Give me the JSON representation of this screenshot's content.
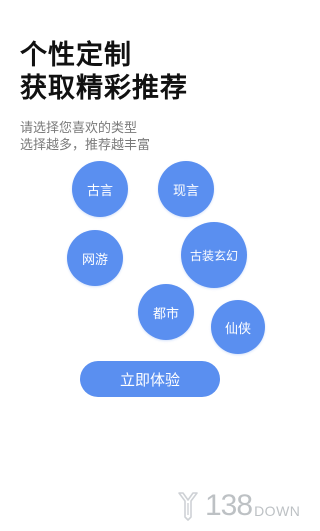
{
  "header": {
    "title_line1": "个性定制",
    "title_line2": "获取精彩推荐"
  },
  "instructions": {
    "line1": "请选择您喜欢的类型",
    "line2": "选择越多，推荐越丰富"
  },
  "genres": [
    {
      "label": "古言"
    },
    {
      "label": "现言"
    },
    {
      "label": "网游"
    },
    {
      "label": "古装玄幻"
    },
    {
      "label": "都市"
    },
    {
      "label": "仙侠"
    }
  ],
  "cta": {
    "label": "立即体验"
  },
  "watermark": {
    "number": "138",
    "text": "DOWN",
    "logo_icon": "shield-logo-icon"
  },
  "colors": {
    "accent": "#5a8ff0",
    "title": "#111111",
    "subtitle": "#7a7a7a",
    "background": "#ffffff"
  }
}
